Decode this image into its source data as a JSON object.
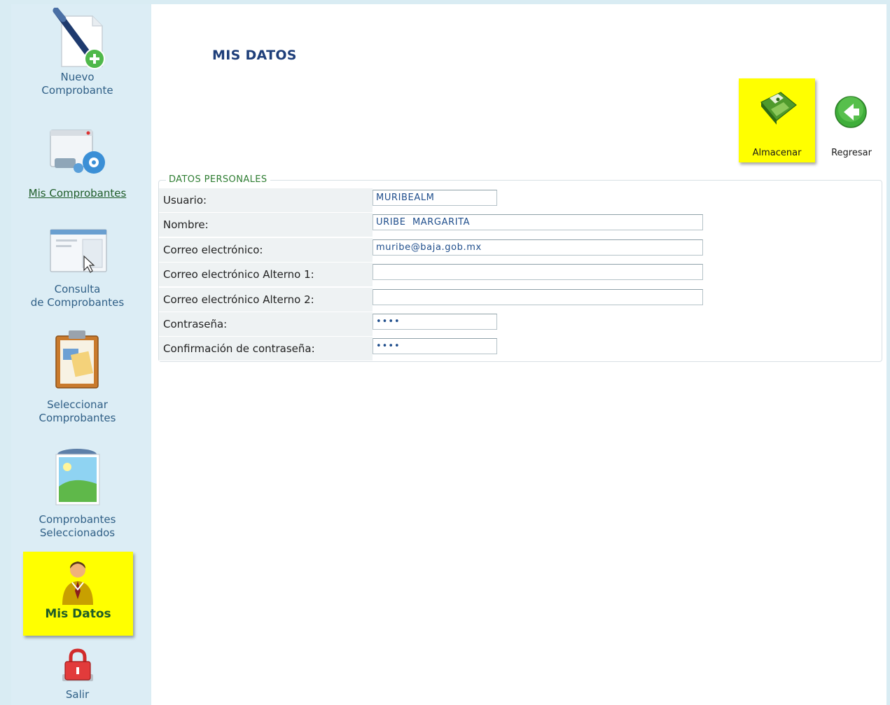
{
  "sidebar": {
    "items": [
      {
        "label_1": "Nuevo",
        "label_2": "Comprobante",
        "icon": "new-document-pen-icon"
      },
      {
        "label": "Mis Comprobantes",
        "icon": "window-gear-icon"
      },
      {
        "label_1": "Consulta",
        "label_2": "de Comprobantes",
        "icon": "window-cursor-icon"
      },
      {
        "label_1": "Seleccionar",
        "label_2": "Comprobantes",
        "icon": "clipboard-icon"
      },
      {
        "label_1": "Comprobantes",
        "label_2": "Seleccionados",
        "icon": "landscape-window-icon"
      },
      {
        "label": "Mis Datos",
        "icon": "user-icon",
        "active": true
      },
      {
        "label": "Salir",
        "icon": "lock-icon"
      }
    ]
  },
  "main": {
    "title": "MIS DATOS",
    "toolbar": {
      "save_label": "Almacenar",
      "back_label": "Regresar"
    },
    "section_legend": "DATOS PERSONALES",
    "fields": [
      {
        "label": "Usuario:",
        "value": "MURIBEALM"
      },
      {
        "label": "Nombre:",
        "value": "URIBE  MARGARITA"
      },
      {
        "label": "Correo electrónico:",
        "value": "muribe@baja.gob.mx"
      },
      {
        "label": "Correo electrónico Alterno 1:",
        "value": ""
      },
      {
        "label": "Correo electrónico Alterno 2:",
        "value": ""
      },
      {
        "label": "Contraseña:",
        "value": "••••"
      },
      {
        "label": "Confirmación de contraseña:",
        "value": "••••"
      }
    ]
  },
  "colors": {
    "active_highlight": "#ffff00",
    "sidebar_bg": "#dcedf5",
    "title_blue": "#1f3f7a",
    "link_green": "#1e5c28"
  }
}
